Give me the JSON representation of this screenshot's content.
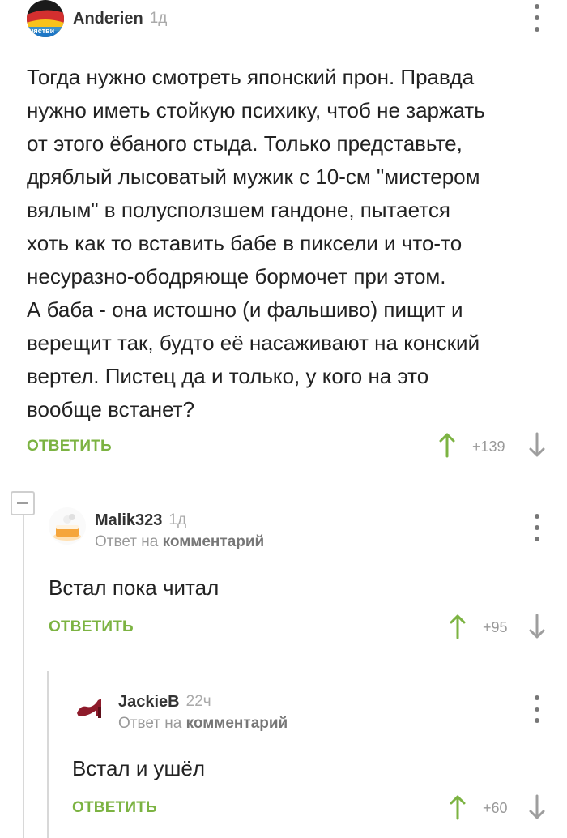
{
  "colors": {
    "accent_green": "#7cb342",
    "text": "#222222",
    "muted": "#999999"
  },
  "comments": [
    {
      "nick": "Anderien",
      "age": "1д",
      "avatar_icon": "flag-avatar-icon",
      "avatar_badge": "нястви",
      "text_lines": [
        "Тогда нужно смотреть японский прон. Правда",
        "нужно иметь стойкую психику, чтоб не заржать",
        "от этого ёбаного стыда. Только представьте,",
        "дряблый лысоватый мужик с 10-см \"мистером",
        "вялым\" в полусползшем гандоне, пытается",
        "хоть как то вставить бабе в пиксели и что-то",
        "несуразно-ободряюще бормочет при этом.",
        "А баба - она истошно (и фальшиво) пищит и",
        "верещит так, будто её насаживают на конский",
        "вертел. Пистец да и только, у кого на это",
        "вообще встанет?"
      ],
      "reply_label": "ОТВЕТИТЬ",
      "score": "+139"
    },
    {
      "nick": "Malik323",
      "age": "1д",
      "avatar_icon": "cake-avatar-icon",
      "reply_to_prefix": "Ответ на",
      "reply_to_target": "комментарий",
      "text_lines": [
        "Встал пока читал"
      ],
      "reply_label": "ОТВЕТИТЬ",
      "score": "+95"
    },
    {
      "nick": "JackieB",
      "age": "22ч",
      "avatar_icon": "shoe-avatar-icon",
      "reply_to_prefix": "Ответ на",
      "reply_to_target": "комментарий",
      "text_lines": [
        "Встал и ушёл"
      ],
      "reply_label": "ОТВЕТИТЬ",
      "score": "+60"
    }
  ]
}
